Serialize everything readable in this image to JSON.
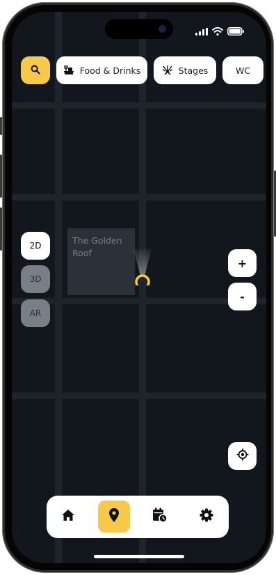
{
  "colors": {
    "accent": "#f7c948",
    "map_bg": "#12161d",
    "road": "#1e232c",
    "building": "#2b3039",
    "control_bg": "#ffffff",
    "inactive_mode": "#7a7e86"
  },
  "status_bar": {
    "icons": [
      "cellular-signal-icon",
      "wifi-icon",
      "battery-icon"
    ]
  },
  "filters": {
    "search_icon": "search-icon",
    "items": [
      {
        "label": "Food & Drinks",
        "icon": "food-drinks-icon"
      },
      {
        "label": "Stages",
        "icon": "stages-icon"
      },
      {
        "label": "WC",
        "icon": ""
      }
    ]
  },
  "map": {
    "building_label": "The Golden Roof",
    "location_marker": "user-location-marker"
  },
  "view_modes": {
    "items": [
      "2D",
      "3D",
      "AR"
    ],
    "selected": "2D"
  },
  "zoom": {
    "in_label": "+",
    "out_label": "-"
  },
  "recenter_icon": "locate-icon",
  "bottom_nav": {
    "items": [
      "home-icon",
      "map-pin-icon",
      "schedule-icon",
      "settings-icon"
    ],
    "selected": "map-pin-icon"
  }
}
